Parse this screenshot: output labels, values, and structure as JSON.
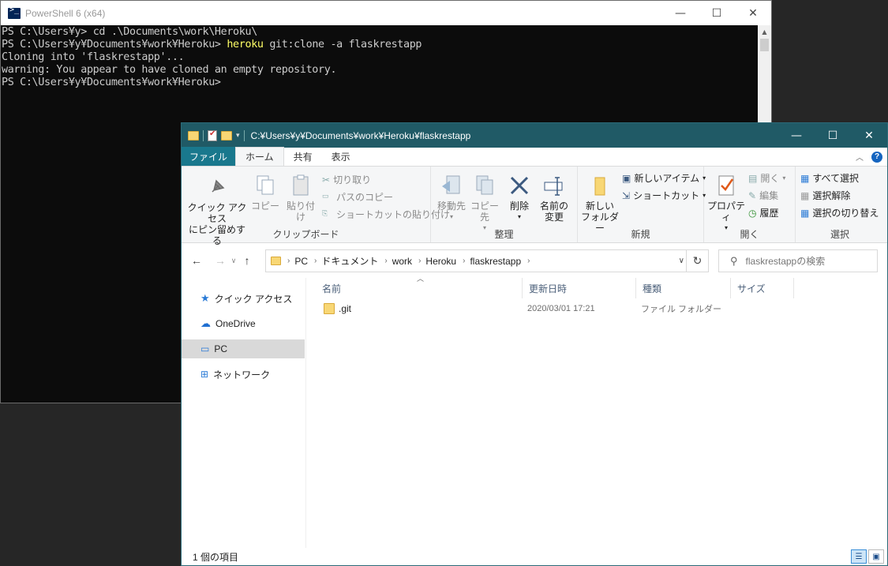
{
  "powershell": {
    "title": "PowerShell 6 (x64)",
    "lines": [
      {
        "prompt": "PS C:\\Users¥y> ",
        "cmd": "cd .\\Documents\\work\\Heroku\\",
        "kw": ""
      },
      {
        "prompt": "PS C:\\Users¥y¥Documents¥work¥Heroku> ",
        "kw": "heroku",
        "cmd": " git:clone -a flaskrestapp"
      },
      {
        "prompt": "",
        "kw": "",
        "cmd": "Cloning into 'flaskrestapp'..."
      },
      {
        "prompt": "",
        "kw": "",
        "cmd": "warning: You appear to have cloned an empty repository."
      },
      {
        "prompt": "PS C:\\Users¥y¥Documents¥work¥Heroku>",
        "kw": "",
        "cmd": ""
      }
    ],
    "caption": {
      "min": "—",
      "max": "☐",
      "close": "✕"
    }
  },
  "explorer": {
    "title": "C:¥Users¥y¥Documents¥work¥Heroku¥flaskrestapp",
    "caption": {
      "min": "—",
      "max": "☐",
      "close": "✕"
    },
    "tabs": {
      "file": "ファイル",
      "home": "ホーム",
      "share": "共有",
      "view": "表示"
    },
    "ribbon": {
      "clipboard": {
        "label": "クリップボード",
        "pin": "クイック アクセス\nにピン留めする",
        "copy": "コピー",
        "paste": "貼り付け",
        "cut": "切り取り",
        "copy_path": "パスのコピー",
        "paste_shortcut": "ショートカットの貼り付け"
      },
      "organize": {
        "label": "整理",
        "move_to": "移動先",
        "copy_to": "コピー先",
        "delete": "削除",
        "rename": "名前の\n変更"
      },
      "new": {
        "label": "新規",
        "new_folder": "新しい\nフォルダー",
        "new_item": "新しいアイテム",
        "shortcut": "ショートカット"
      },
      "open": {
        "label": "開く",
        "properties": "プロパティ",
        "open": "開く",
        "edit": "編集",
        "history": "履歴"
      },
      "select": {
        "label": "選択",
        "select_all": "すべて選択",
        "select_none": "選択解除",
        "invert": "選択の切り替え"
      }
    },
    "breadcrumb": [
      "PC",
      "ドキュメント",
      "work",
      "Heroku",
      "flaskrestapp"
    ],
    "search_placeholder": "flaskrestappの検索",
    "nav": {
      "quick_access": "クイック アクセス",
      "onedrive": "OneDrive",
      "pc": "PC",
      "network": "ネットワーク"
    },
    "columns": {
      "name": "名前",
      "date": "更新日時",
      "type": "種類",
      "size": "サイズ"
    },
    "files": [
      {
        "name": ".git",
        "date": "2020/03/01 17:21",
        "type": "ファイル フォルダー",
        "size": ""
      }
    ],
    "status": "1 個の項目"
  }
}
